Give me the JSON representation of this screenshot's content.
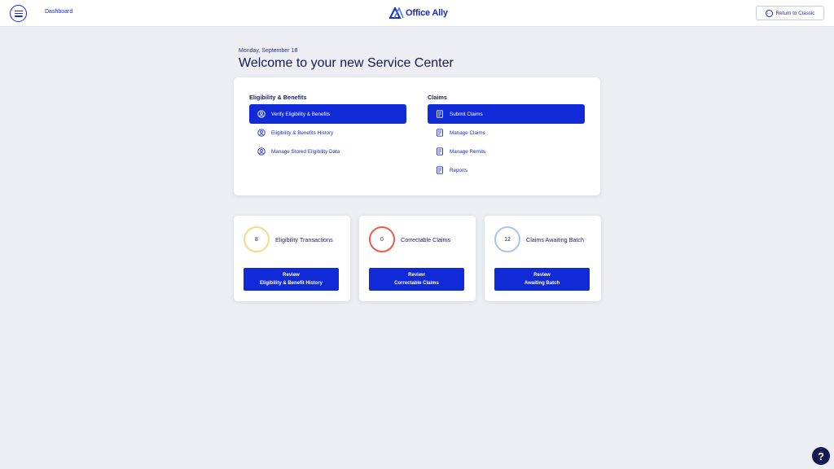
{
  "header": {
    "breadcrumb": "Dashboard",
    "logo_text": "Office Ally",
    "return_label": "Return to Classic"
  },
  "page": {
    "date": "Monday, September 18",
    "title": "Welcome to your new Service Center"
  },
  "eligibility": {
    "title": "Eligibility & Benefits",
    "items": [
      {
        "label": "Verify Eligibility & Benefits",
        "icon": "user-check-icon",
        "active": true
      },
      {
        "label": "Eligibility & Benefits History",
        "icon": "user-check-icon",
        "active": false
      },
      {
        "label": "Manage Stored Eligibility Data",
        "icon": "user-check-icon",
        "active": false
      }
    ]
  },
  "claims": {
    "title": "Claims",
    "items": [
      {
        "label": "Submit Claims",
        "icon": "document-icon",
        "active": true
      },
      {
        "label": "Manage Claims",
        "icon": "document-icon",
        "active": false
      },
      {
        "label": "Manage Remits",
        "icon": "document-icon",
        "active": false
      },
      {
        "label": "Reports",
        "icon": "document-icon",
        "active": false
      }
    ]
  },
  "stats": [
    {
      "count": "8",
      "label": "Eligibility Transactions",
      "ring_color": "#f7d98a",
      "button_line1": "Review",
      "button_line2": "Eligibility & Benefit History"
    },
    {
      "count": "0",
      "label": "Correctable Claims",
      "ring_color": "#ef5a4e",
      "button_line1": "Review",
      "button_line2": "Correctable Claims"
    },
    {
      "count": "12",
      "label": "Claims Awaiting Batch",
      "ring_color": "#aac3ee",
      "button_line1": "Review",
      "button_line2": "Awaiting Batch"
    }
  ],
  "colors": {
    "accent": "#0f2ad6",
    "background": "#eceef3",
    "help": "#141a4e"
  },
  "help_label": "?"
}
